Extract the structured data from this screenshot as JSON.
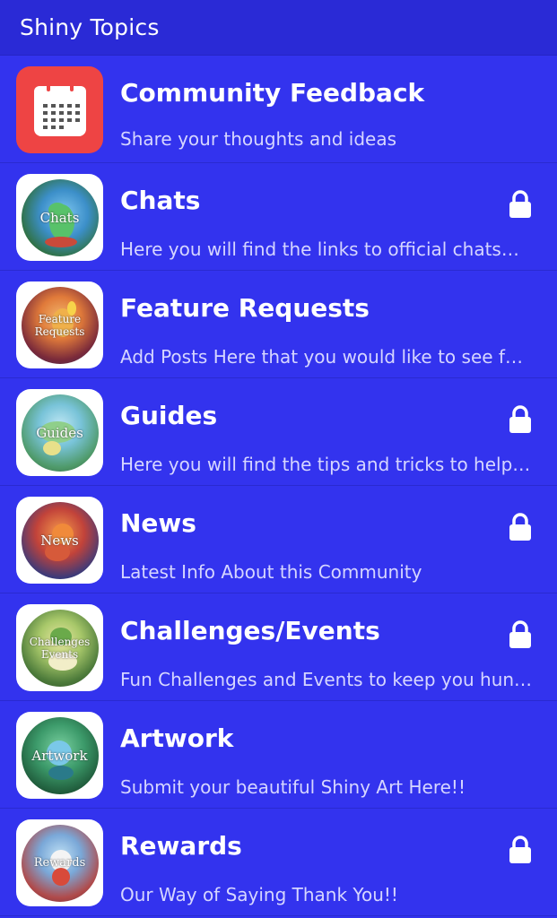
{
  "header": {
    "title": "Shiny Topics"
  },
  "items": [
    {
      "title": "Community Feedback",
      "subtitle": "Share your thoughts and ideas",
      "icon": "calendar-icon",
      "locked": false
    },
    {
      "title": "Chats",
      "subtitle": "Here you will find the links to official chats…",
      "icon_text": "Chats",
      "locked": true
    },
    {
      "title": "Feature Requests",
      "subtitle": "Add Posts Here that you would like to see f…",
      "icon_text": "Feature Requests",
      "locked": false
    },
    {
      "title": "Guides",
      "subtitle": "Here you will find the tips and tricks to help…",
      "icon_text": "Guides",
      "locked": true
    },
    {
      "title": "News",
      "subtitle": "Latest Info About this Community",
      "icon_text": "News",
      "locked": true
    },
    {
      "title": "Challenges/Events",
      "subtitle": "Fun Challenges and Events to keep you hun…",
      "icon_text": "Challenges Events",
      "locked": true
    },
    {
      "title": "Artwork",
      "subtitle": "Submit your beautiful Shiny Art Here!!",
      "icon_text": "Artwork",
      "locked": false
    },
    {
      "title": "Rewards",
      "subtitle": "Our Way of Saying Thank You!!",
      "icon_text": "Rewards",
      "locked": true
    }
  ],
  "colors": {
    "background": "#3333ee",
    "header": "#2a2ad6",
    "calendar_red": "#ee4444",
    "subtitle": "#d6d6ff"
  }
}
